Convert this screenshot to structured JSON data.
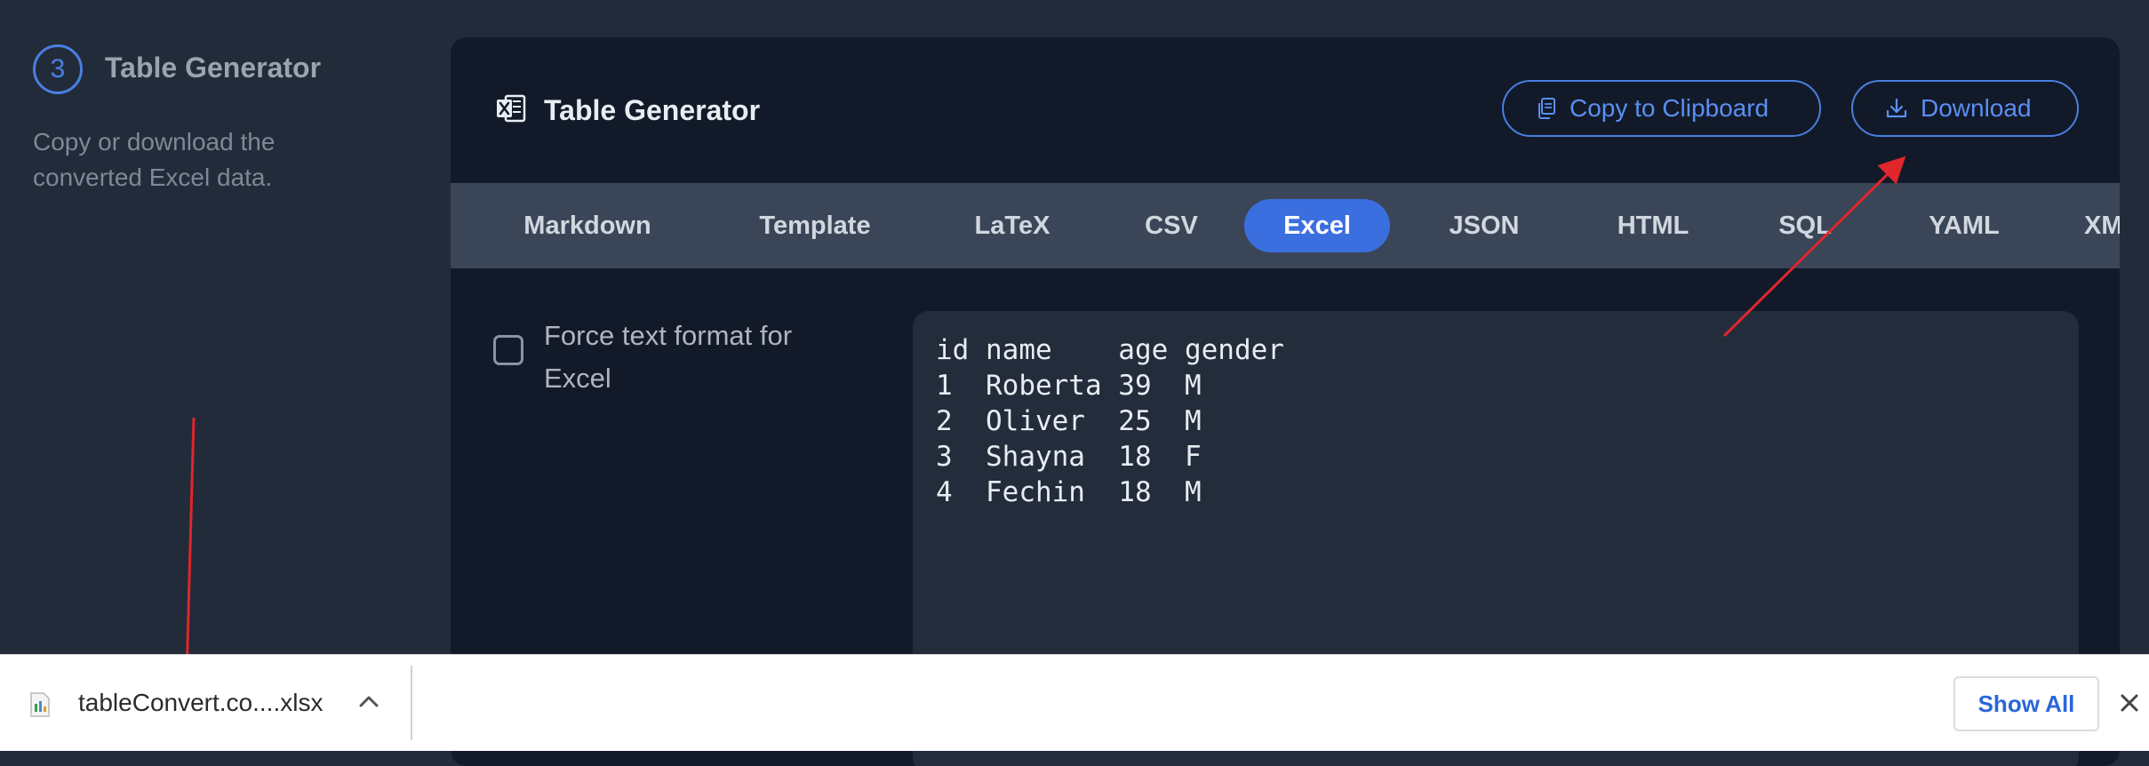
{
  "step": {
    "number": "3",
    "title": "Table Generator",
    "description": "Copy or download the converted Excel data."
  },
  "panel": {
    "title": "Table Generator",
    "icon": "excel-icon",
    "copy_label": "Copy to Clipboard",
    "download_label": "Download"
  },
  "tabs": [
    "Markdown",
    "Template",
    "LaTeX",
    "CSV",
    "Excel",
    "JSON",
    "HTML",
    "SQL",
    "YAML",
    "XML"
  ],
  "active_tab": "Excel",
  "options": {
    "force_text_label": "Force text format for Excel",
    "force_text_checked": false
  },
  "output": {
    "header": [
      "id",
      "name",
      "age",
      "gender"
    ],
    "rows": [
      [
        "1",
        "Roberta",
        "39",
        "M"
      ],
      [
        "2",
        "Oliver",
        "25",
        "M"
      ],
      [
        "3",
        "Shayna",
        "18",
        "F"
      ],
      [
        "4",
        "Fechin",
        "18",
        "M"
      ]
    ]
  },
  "download_bar": {
    "file_name": "tableConvert.co....xlsx",
    "show_all_label": "Show All"
  },
  "colors": {
    "accent": "#3b6fe0",
    "annotation_arrow": "#e0262b"
  }
}
